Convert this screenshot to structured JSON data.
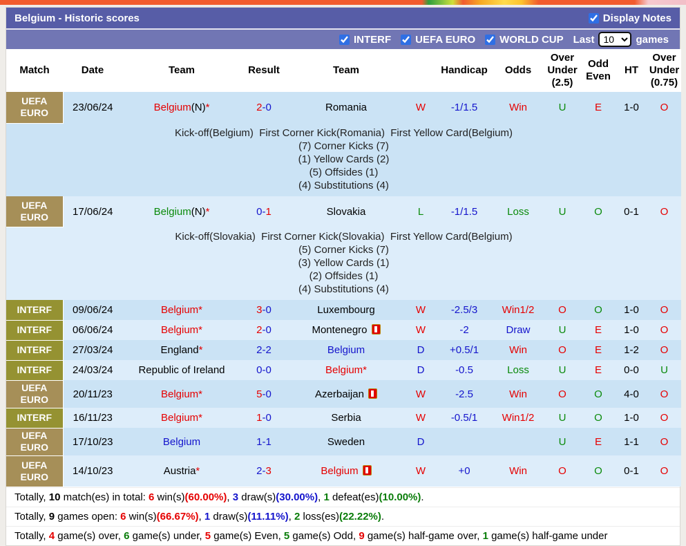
{
  "title_bar": {
    "title": "Belgium - Historic scores",
    "display_notes_label": "Display Notes",
    "display_notes_checked": true
  },
  "filter_bar": {
    "checkboxes": [
      {
        "label": "INTERF",
        "checked": true
      },
      {
        "label": "UEFA EURO",
        "checked": true
      },
      {
        "label": "WORLD CUP",
        "checked": true
      }
    ],
    "last_label": "Last",
    "selected_count": "10",
    "games_label": "games"
  },
  "colors": {
    "title_bar_bg": "#575da7",
    "filter_bar_bg": "#7176b4",
    "league_euro_bg": "#a68f58",
    "league_interf_bg": "#959232",
    "row_odd_bg": "#cbe3f5",
    "row_even_bg": "#ddedfa",
    "win_red": "#e60000",
    "draw_blue": "#1414cc",
    "loss_green": "#0a8a0a"
  },
  "table": {
    "columns": [
      "Match",
      "Date",
      "Team",
      "Result",
      "Team",
      "",
      "Handicap",
      "Odds",
      "Over Under (2.5)",
      "Odd Even",
      "HT",
      "Over Under (0.75)"
    ],
    "rows": [
      {
        "league": "UEFA EURO",
        "lc": "euro",
        "date": "23/06/24",
        "team1": [
          [
            "Belgium",
            "red"
          ],
          [
            "(N)",
            "black"
          ],
          [
            "*",
            "red"
          ]
        ],
        "result": [
          [
            "2",
            "red"
          ],
          [
            "-0",
            "blue"
          ]
        ],
        "team2": [
          [
            "Romania",
            "black"
          ]
        ],
        "wdl": [
          [
            "W",
            "red"
          ]
        ],
        "handicap": [
          [
            "-1/1.5",
            "blue"
          ]
        ],
        "odds": [
          [
            "Win",
            "red"
          ]
        ],
        "ou25": [
          [
            "U",
            "green"
          ]
        ],
        "oddeven": [
          [
            "E",
            "red"
          ]
        ],
        "ht": [
          [
            "1-0",
            "black"
          ]
        ],
        "ou075": [
          [
            "O",
            "red"
          ]
        ],
        "notes": [
          "Kick-off(Belgium)  First Corner Kick(Romania)  First Yellow Card(Belgium)",
          "(7) Corner Kicks (7)",
          "(1) Yellow Cards (2)",
          "(5) Offsides (1)",
          "(4) Substitutions (4)"
        ]
      },
      {
        "league": "UEFA EURO",
        "lc": "euro",
        "date": "17/06/24",
        "team1": [
          [
            "Belgium",
            "green"
          ],
          [
            "(N)",
            "black"
          ],
          [
            "*",
            "red"
          ]
        ],
        "result": [
          [
            "0-",
            "blue"
          ],
          [
            "1",
            "red"
          ]
        ],
        "team2": [
          [
            "Slovakia",
            "black"
          ]
        ],
        "wdl": [
          [
            "L",
            "green"
          ]
        ],
        "handicap": [
          [
            "-1/1.5",
            "blue"
          ]
        ],
        "odds": [
          [
            "Loss",
            "green"
          ]
        ],
        "ou25": [
          [
            "U",
            "green"
          ]
        ],
        "oddeven": [
          [
            "O",
            "green"
          ]
        ],
        "ht": [
          [
            "0-1",
            "black"
          ]
        ],
        "ou075": [
          [
            "O",
            "red"
          ]
        ],
        "notes": [
          "Kick-off(Slovakia)  First Corner Kick(Slovakia)  First Yellow Card(Belgium)",
          "(5) Corner Kicks (7)",
          "(3) Yellow Cards (1)",
          "(2) Offsides (1)",
          "(4) Substitutions (4)"
        ]
      },
      {
        "league": "INTERF",
        "lc": "interf",
        "date": "09/06/24",
        "team1": [
          [
            "Belgium",
            "red"
          ],
          [
            "*",
            "red"
          ]
        ],
        "result": [
          [
            "3",
            "red"
          ],
          [
            "-0",
            "blue"
          ]
        ],
        "team2": [
          [
            "Luxembourg",
            "black"
          ]
        ],
        "wdl": [
          [
            "W",
            "red"
          ]
        ],
        "handicap": [
          [
            "-2.5/3",
            "blue"
          ]
        ],
        "odds": [
          [
            "Win1/2",
            "red"
          ]
        ],
        "ou25": [
          [
            "O",
            "red"
          ]
        ],
        "oddeven": [
          [
            "O",
            "green"
          ]
        ],
        "ht": [
          [
            "1-0",
            "black"
          ]
        ],
        "ou075": [
          [
            "O",
            "red"
          ]
        ]
      },
      {
        "league": "INTERF",
        "lc": "interf",
        "date": "06/06/24",
        "team1": [
          [
            "Belgium",
            "red"
          ],
          [
            "*",
            "red"
          ]
        ],
        "result": [
          [
            "2",
            "red"
          ],
          [
            "-0",
            "blue"
          ]
        ],
        "team2": [
          [
            "Montenegro",
            "black"
          ]
        ],
        "rc2": true,
        "wdl": [
          [
            "W",
            "red"
          ]
        ],
        "handicap": [
          [
            "-2",
            "blue"
          ]
        ],
        "odds": [
          [
            "Draw",
            "blue"
          ]
        ],
        "ou25": [
          [
            "U",
            "green"
          ]
        ],
        "oddeven": [
          [
            "E",
            "red"
          ]
        ],
        "ht": [
          [
            "1-0",
            "black"
          ]
        ],
        "ou075": [
          [
            "O",
            "red"
          ]
        ]
      },
      {
        "league": "INTERF",
        "lc": "interf",
        "date": "27/03/24",
        "team1": [
          [
            "England",
            "black"
          ],
          [
            "*",
            "red"
          ]
        ],
        "result": [
          [
            "2-2",
            "blue"
          ]
        ],
        "team2": [
          [
            "Belgium",
            "blue"
          ]
        ],
        "wdl": [
          [
            "D",
            "blue"
          ]
        ],
        "handicap": [
          [
            "+0.5/1",
            "blue"
          ]
        ],
        "odds": [
          [
            "Win",
            "red"
          ]
        ],
        "ou25": [
          [
            "O",
            "red"
          ]
        ],
        "oddeven": [
          [
            "E",
            "red"
          ]
        ],
        "ht": [
          [
            "1-2",
            "black"
          ]
        ],
        "ou075": [
          [
            "O",
            "red"
          ]
        ]
      },
      {
        "league": "INTERF",
        "lc": "interf",
        "date": "24/03/24",
        "team1": [
          [
            "Republic of Ireland",
            "black"
          ]
        ],
        "result": [
          [
            "0-0",
            "blue"
          ]
        ],
        "team2": [
          [
            "Belgium",
            "red"
          ],
          [
            "*",
            "red"
          ]
        ],
        "wdl": [
          [
            "D",
            "blue"
          ]
        ],
        "handicap": [
          [
            "-0.5",
            "blue"
          ]
        ],
        "odds": [
          [
            "Loss",
            "green"
          ]
        ],
        "ou25": [
          [
            "U",
            "green"
          ]
        ],
        "oddeven": [
          [
            "E",
            "red"
          ]
        ],
        "ht": [
          [
            "0-0",
            "black"
          ]
        ],
        "ou075": [
          [
            "U",
            "green"
          ]
        ]
      },
      {
        "league": "UEFA EURO",
        "lc": "euro",
        "date": "20/11/23",
        "team1": [
          [
            "Belgium",
            "red"
          ],
          [
            "*",
            "red"
          ]
        ],
        "result": [
          [
            "5",
            "red"
          ],
          [
            "-0",
            "blue"
          ]
        ],
        "team2": [
          [
            "Azerbaijan",
            "black"
          ]
        ],
        "rc2": true,
        "wdl": [
          [
            "W",
            "red"
          ]
        ],
        "handicap": [
          [
            "-2.5",
            "blue"
          ]
        ],
        "odds": [
          [
            "Win",
            "red"
          ]
        ],
        "ou25": [
          [
            "O",
            "red"
          ]
        ],
        "oddeven": [
          [
            "O",
            "green"
          ]
        ],
        "ht": [
          [
            "4-0",
            "black"
          ]
        ],
        "ou075": [
          [
            "O",
            "red"
          ]
        ]
      },
      {
        "league": "INTERF",
        "lc": "interf",
        "date": "16/11/23",
        "team1": [
          [
            "Belgium",
            "red"
          ],
          [
            "*",
            "red"
          ]
        ],
        "result": [
          [
            "1",
            "red"
          ],
          [
            "-0",
            "blue"
          ]
        ],
        "team2": [
          [
            "Serbia",
            "black"
          ]
        ],
        "wdl": [
          [
            "W",
            "red"
          ]
        ],
        "handicap": [
          [
            "-0.5/1",
            "blue"
          ]
        ],
        "odds": [
          [
            "Win1/2",
            "red"
          ]
        ],
        "ou25": [
          [
            "U",
            "green"
          ]
        ],
        "oddeven": [
          [
            "O",
            "green"
          ]
        ],
        "ht": [
          [
            "1-0",
            "black"
          ]
        ],
        "ou075": [
          [
            "O",
            "red"
          ]
        ]
      },
      {
        "league": "UEFA EURO",
        "lc": "euro",
        "date": "17/10/23",
        "team1": [
          [
            "Belgium",
            "blue"
          ]
        ],
        "result": [
          [
            "1-1",
            "blue"
          ]
        ],
        "team2": [
          [
            "Sweden",
            "black"
          ]
        ],
        "wdl": [
          [
            "D",
            "blue"
          ]
        ],
        "handicap": [],
        "odds": [],
        "ou25": [
          [
            "U",
            "green"
          ]
        ],
        "oddeven": [
          [
            "E",
            "red"
          ]
        ],
        "ht": [
          [
            "1-1",
            "black"
          ]
        ],
        "ou075": [
          [
            "O",
            "red"
          ]
        ]
      },
      {
        "league": "UEFA EURO",
        "lc": "euro",
        "date": "14/10/23",
        "team1": [
          [
            "Austria",
            "black"
          ],
          [
            "*",
            "red"
          ]
        ],
        "result": [
          [
            "2-",
            "blue"
          ],
          [
            "3",
            "red"
          ]
        ],
        "team2": [
          [
            "Belgium",
            "red"
          ]
        ],
        "rc2": true,
        "wdl": [
          [
            "W",
            "red"
          ]
        ],
        "handicap": [
          [
            "+0",
            "blue"
          ]
        ],
        "odds": [
          [
            "Win",
            "red"
          ]
        ],
        "ou25": [
          [
            "O",
            "red"
          ]
        ],
        "oddeven": [
          [
            "O",
            "green"
          ]
        ],
        "ht": [
          [
            "0-1",
            "black"
          ]
        ],
        "ou075": [
          [
            "O",
            "red"
          ]
        ]
      }
    ]
  },
  "summary": {
    "lines": [
      [
        [
          "Totally, ",
          "n"
        ],
        [
          "10",
          "b"
        ],
        [
          " match(es) in total: ",
          "n"
        ],
        [
          "6",
          "r"
        ],
        [
          " win(s)",
          "n"
        ],
        [
          "(60.00%)",
          "r"
        ],
        [
          ", ",
          "n"
        ],
        [
          "3",
          "bl"
        ],
        [
          " draw(s)",
          "n"
        ],
        [
          "(30.00%)",
          "bl"
        ],
        [
          ", ",
          "n"
        ],
        [
          "1",
          "g"
        ],
        [
          " defeat(es)",
          "n"
        ],
        [
          "(10.00%)",
          "g"
        ],
        [
          ".",
          "n"
        ]
      ],
      [
        [
          "Totally, ",
          "n"
        ],
        [
          "9",
          "b"
        ],
        [
          " games open: ",
          "n"
        ],
        [
          "6",
          "r"
        ],
        [
          " win(s)",
          "n"
        ],
        [
          "(66.67%)",
          "r"
        ],
        [
          ", ",
          "n"
        ],
        [
          "1",
          "bl"
        ],
        [
          " draw(s)",
          "n"
        ],
        [
          "(11.11%)",
          "bl"
        ],
        [
          ", ",
          "n"
        ],
        [
          "2",
          "g"
        ],
        [
          " loss(es)",
          "n"
        ],
        [
          "(22.22%)",
          "g"
        ],
        [
          ".",
          "n"
        ]
      ],
      [
        [
          "Totally, ",
          "n"
        ],
        [
          "4",
          "r"
        ],
        [
          " game(s) over, ",
          "n"
        ],
        [
          "6",
          "g"
        ],
        [
          " game(s) under, ",
          "n"
        ],
        [
          "5",
          "r"
        ],
        [
          " game(s) Even, ",
          "n"
        ],
        [
          "5",
          "g"
        ],
        [
          " game(s) Odd, ",
          "n"
        ],
        [
          "9",
          "r"
        ],
        [
          " game(s) half-game over, ",
          "n"
        ],
        [
          "1",
          "g"
        ],
        [
          " game(s) half-game under",
          "n"
        ]
      ]
    ]
  },
  "icons": {
    "red_card": "red-card-icon",
    "display_notes_checkbox": "checked",
    "filter_checkboxes": "checked"
  }
}
